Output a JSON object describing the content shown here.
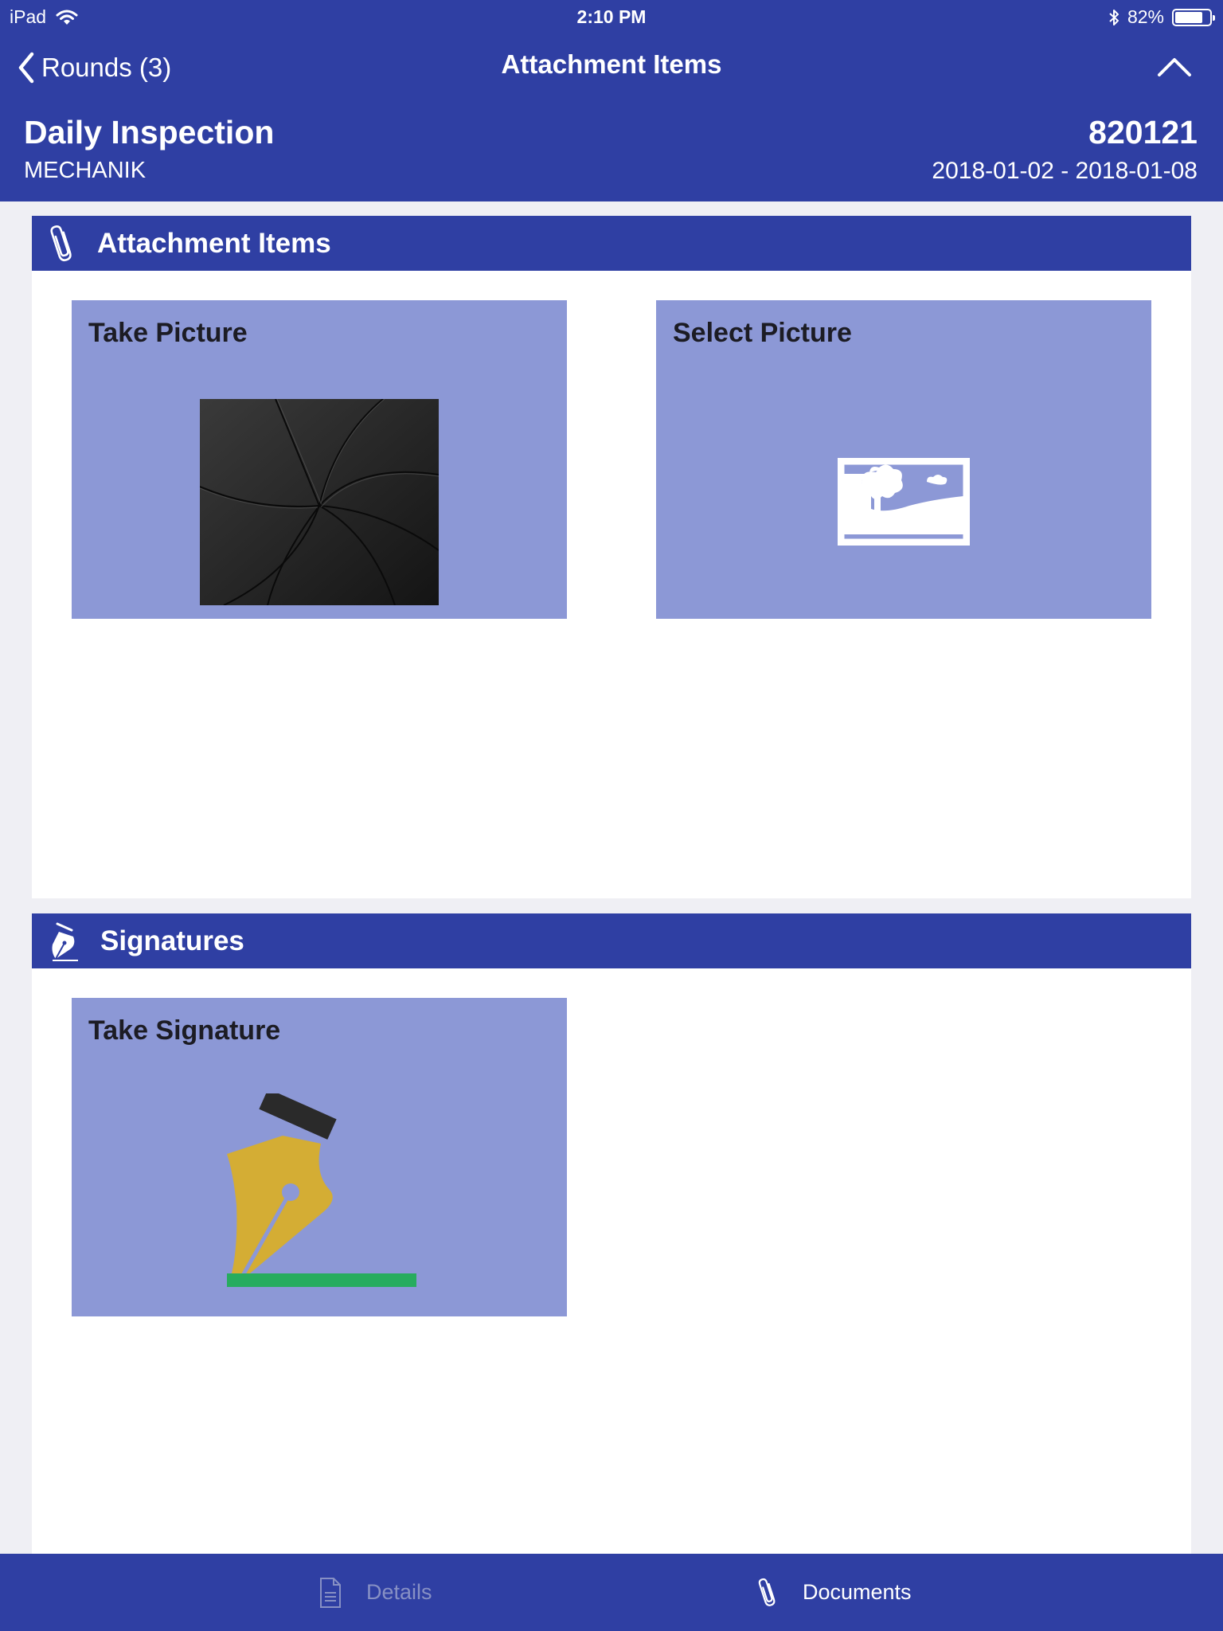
{
  "status_bar": {
    "device": "iPad",
    "time": "2:10 PM",
    "battery": "82%",
    "battery_level": 0.82
  },
  "nav": {
    "back_label": "Rounds (3)",
    "title": "Attachment Items"
  },
  "inspection": {
    "title": "Daily Inspection",
    "subtitle": "MECHANIK",
    "id": "820121",
    "dates": "2018-01-02 - 2018-01-08"
  },
  "sections": {
    "attachments": {
      "title": "Attachment Items",
      "tiles": [
        {
          "label": "Take Picture",
          "icon": "camera-shutter-icon"
        },
        {
          "label": "Select Picture",
          "icon": "photo-gallery-icon"
        }
      ]
    },
    "signatures": {
      "title": "Signatures",
      "tiles": [
        {
          "label": "Take Signature",
          "icon": "fountain-pen-icon"
        }
      ]
    }
  },
  "tabbar": {
    "items": [
      {
        "label": "Details",
        "icon": "document-icon",
        "active": false
      },
      {
        "label": "Documents",
        "icon": "paperclip-icon",
        "active": true
      }
    ]
  },
  "colors": {
    "primary": "#2f3fa3",
    "tile": "#8c98d6",
    "background": "#efeff4",
    "inactive_tab": "#8790c4"
  }
}
